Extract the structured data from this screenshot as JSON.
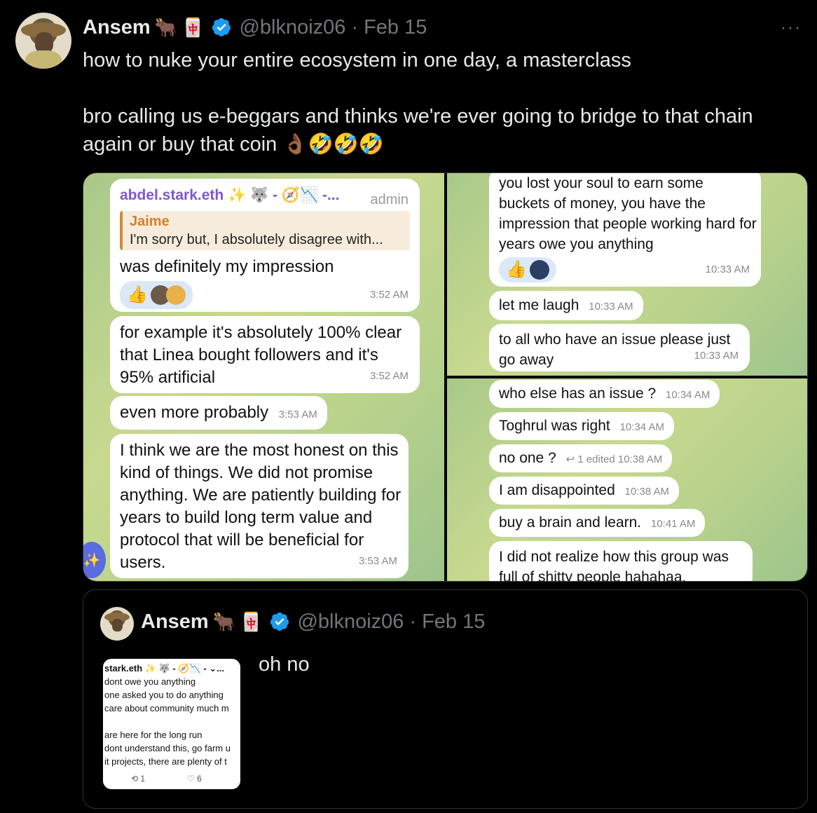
{
  "tweet": {
    "author_name": "Ansem",
    "author_emojis": [
      "🐂",
      "🀄"
    ],
    "handle": "@blknoiz06",
    "separator": "·",
    "date": "Feb 15",
    "more_label": "···",
    "text_line1": "how to nuke your entire ecosystem in one day, a masterclass",
    "text_line2": "bro calling us e-beggars and thinks we're ever going to bridge to that chain again or buy that coin 👌🏾🤣🤣🤣"
  },
  "chat_left": {
    "sender": "abdel.stark.eth ✨ 🐺 - 🧭📉 -...",
    "admin_label": "admin",
    "quote_name": "Jaime",
    "quote_text": "I'm sorry but, I absolutely disagree with...",
    "msg1": "was definitely my impression",
    "msg1_time": "3:52 AM",
    "msg1_react": "👍",
    "msg2": "for example it's absolutely 100% clear that Linea bought followers and it's 95% artificial",
    "msg2_time": "3:52 AM",
    "msg3": "even more probably",
    "msg3_time": "3:53 AM",
    "msg4": "I think we are the most honest on this kind of things. We did not promise anything. We are patiently building for years to build long term value and protocol that will be beneficial for users.",
    "msg4_time": "3:53 AM",
    "sparkle": "✨"
  },
  "chat_right_top": {
    "msg1": "you lost your soul to earn some buckets of money, you have the impression that people working hard for years owe you anything",
    "msg1_react": "👍",
    "msg1_time": "10:33 AM",
    "msg2": "let me laugh",
    "msg2_time": "10:33 AM",
    "msg3": "to all who have an issue please just go away",
    "msg3_time": "10:33 AM"
  },
  "chat_right_bottom": {
    "msg1": "who else has an issue ?",
    "msg1_time": "10:34 AM",
    "msg2": "Toghrul was right",
    "msg2_time": "10:34 AM",
    "msg3": "no one ?",
    "msg3_meta": "↩ 1  edited 10:38 AM",
    "msg4": "I am disappointed",
    "msg4_time": "10:38 AM",
    "msg5": "buy a brain and learn.",
    "msg5_time": "10:41 AM",
    "msg6": "I did not realize how this group was full of shitty people hahahaa."
  },
  "quoted_tweet": {
    "author_name": "Ansem",
    "handle": "@blknoiz06",
    "separator": "·",
    "date": "Feb 15",
    "text": "oh no",
    "thumb_lines": [
      "stark.eth ✨ 🐺 - 🧭📉 - ⌄...",
      "dont owe you anything",
      "one asked you to do anything",
      "care about community much m",
      "",
      "are here for the long run",
      "dont understand this, go farm u",
      "it projects, there are plenty of t"
    ],
    "thumb_retweets": "⟲ 1",
    "thumb_likes": "♡ 6"
  },
  "colors": {
    "background": "#000000",
    "text": "#e7e9ea",
    "muted": "#71767b",
    "verified": "#1d9bf0",
    "telegram_sender": "#7f58cf",
    "quote_accent": "#d0822b"
  }
}
